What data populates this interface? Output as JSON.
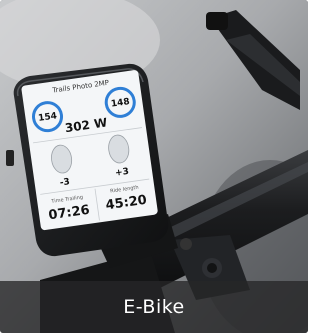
{
  "card": {
    "caption": "E-Bike",
    "image_alt": "Bike computer mounted on e-bike handlebar"
  },
  "device": {
    "page_title": "Trails Photo 2MP",
    "left_gauge": "154",
    "right_gauge": "148",
    "power": "302 W",
    "left_value": "-3",
    "right_value": "+3",
    "time_label": "Time Trailing",
    "time_value": "07:26",
    "ride_label": "Ride length",
    "ride_value": "45:20"
  },
  "colors": {
    "gauge_blue": "#2f7fd6",
    "screen_bg": "#f4f6f8",
    "caption_bar": "#262628"
  }
}
